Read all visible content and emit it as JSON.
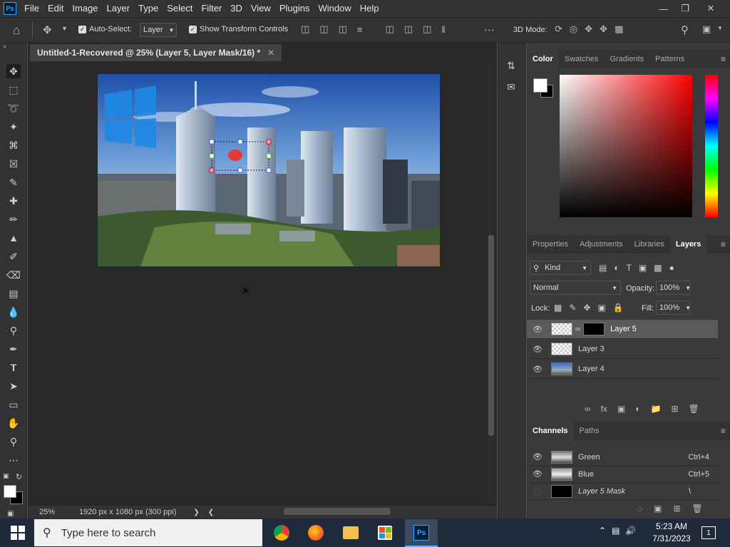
{
  "app": {
    "logo": "Ps",
    "menus": [
      "File",
      "Edit",
      "Image",
      "Layer",
      "Type",
      "Select",
      "Filter",
      "3D",
      "View",
      "Plugins",
      "Window",
      "Help"
    ]
  },
  "options": {
    "auto_select_label": "Auto-Select:",
    "auto_select_value": "Layer",
    "show_transform_label": "Show Transform Controls",
    "mode_label": "3D Mode:"
  },
  "document": {
    "tab_title": "Untitled-1-Recovered @ 25% (Layer 5, Layer Mask/16) *",
    "zoom": "25%",
    "size_info": "1920 px x 1080 px (300 ppi)"
  },
  "color_panel": {
    "tabs": [
      "Color",
      "Swatches",
      "Gradients",
      "Patterns"
    ],
    "active_tab": "Color"
  },
  "layers_panel": {
    "tabs": [
      "Properties",
      "Adjustments",
      "Libraries",
      "Layers"
    ],
    "active_tab": "Layers",
    "filter_kind": "Kind",
    "blend_mode": "Normal",
    "opacity_label": "Opacity:",
    "opacity_value": "100%",
    "lock_label": "Lock:",
    "fill_label": "Fill:",
    "fill_value": "100%",
    "layers": [
      {
        "name": "Layer 5",
        "selected": true
      },
      {
        "name": "Layer 3",
        "selected": false
      },
      {
        "name": "Layer 4",
        "selected": false
      }
    ]
  },
  "channels_panel": {
    "tabs": [
      "Channels",
      "Paths"
    ],
    "active_tab": "Channels",
    "channels": [
      {
        "name": "Green",
        "shortcut": "Ctrl+4"
      },
      {
        "name": "Blue",
        "shortcut": "Ctrl+5"
      },
      {
        "name": "Layer 5 Mask",
        "shortcut": "\\"
      }
    ]
  },
  "taskbar": {
    "search_placeholder": "Type here to search",
    "time": "5:23 AM",
    "date": "7/31/2023",
    "notification_count": "1"
  },
  "colors": {
    "ui_dark": "#323232",
    "canvas_bg": "#282828",
    "panel_bg": "#3a3a3a",
    "selected_layer": "#5a5a5a",
    "accent_blue": "#31a8ff"
  }
}
